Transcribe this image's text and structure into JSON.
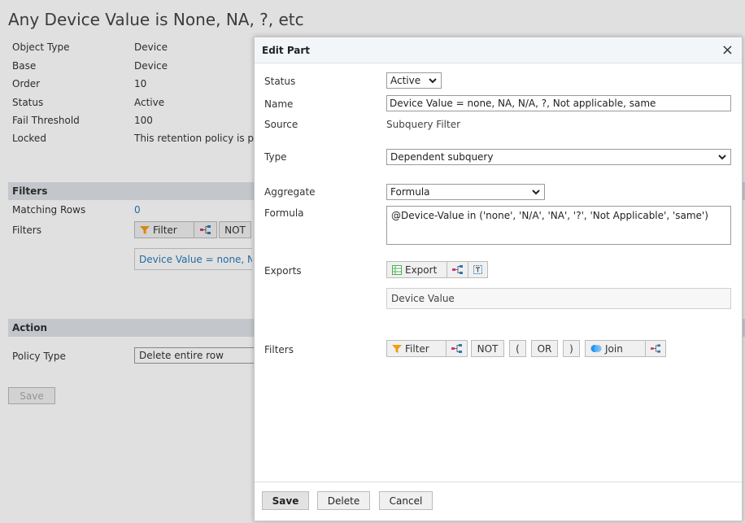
{
  "page": {
    "title": "Any Device Value is None, NA, ?, etc",
    "fields": [
      {
        "label": "Object Type",
        "value": "Device"
      },
      {
        "label": "Base",
        "value": "Device"
      },
      {
        "label": "Order",
        "value": "10"
      },
      {
        "label": "Status",
        "value": "Active"
      },
      {
        "label": "Fail Threshold",
        "value": "100"
      },
      {
        "label": "Locked",
        "value": "This retention policy is part"
      }
    ],
    "filters_section": {
      "title": "Filters",
      "matching_rows_label": "Matching Rows",
      "matching_rows_value": "0",
      "filters_label": "Filters",
      "filter_button": "Filter",
      "not_button": "NOT",
      "filter_link": "Device Value = none, NA, "
    },
    "action_section": {
      "title": "Action",
      "policy_type_label": "Policy Type",
      "policy_type_value": "Delete entire row"
    },
    "save_button": "Save"
  },
  "dialog": {
    "title": "Edit Part",
    "close": "×",
    "status": {
      "label": "Status",
      "value": "Active"
    },
    "name": {
      "label": "Name",
      "value": "Device Value = none, NA, N/A, ?, Not applicable, same"
    },
    "source": {
      "label": "Source",
      "value": "Subquery Filter"
    },
    "type": {
      "label": "Type",
      "value": "Dependent subquery"
    },
    "aggregate": {
      "label": "Aggregate",
      "value": "Formula"
    },
    "formula": {
      "label": "Formula",
      "value": "@Device-Value in ('none', 'N/A', 'NA', '?', 'Not Applicable', 'same')"
    },
    "exports": {
      "label": "Exports",
      "export_button": "Export",
      "value": "Device Value"
    },
    "filters": {
      "label": "Filters",
      "filter_button": "Filter",
      "not_button": "NOT",
      "open_paren": "(",
      "or_button": "OR",
      "close_paren": ")",
      "join_button": "Join"
    },
    "footer": {
      "save": "Save",
      "delete": "Delete",
      "cancel": "Cancel"
    }
  },
  "colors": {
    "accent_link": "#2a7ab8",
    "filter_icon": "#f39c12",
    "tree_icon_pink": "#d63384",
    "tree_icon_blue": "#2a7ab8",
    "export_icon": "#4caf50",
    "join_icon": "#2196f3"
  }
}
